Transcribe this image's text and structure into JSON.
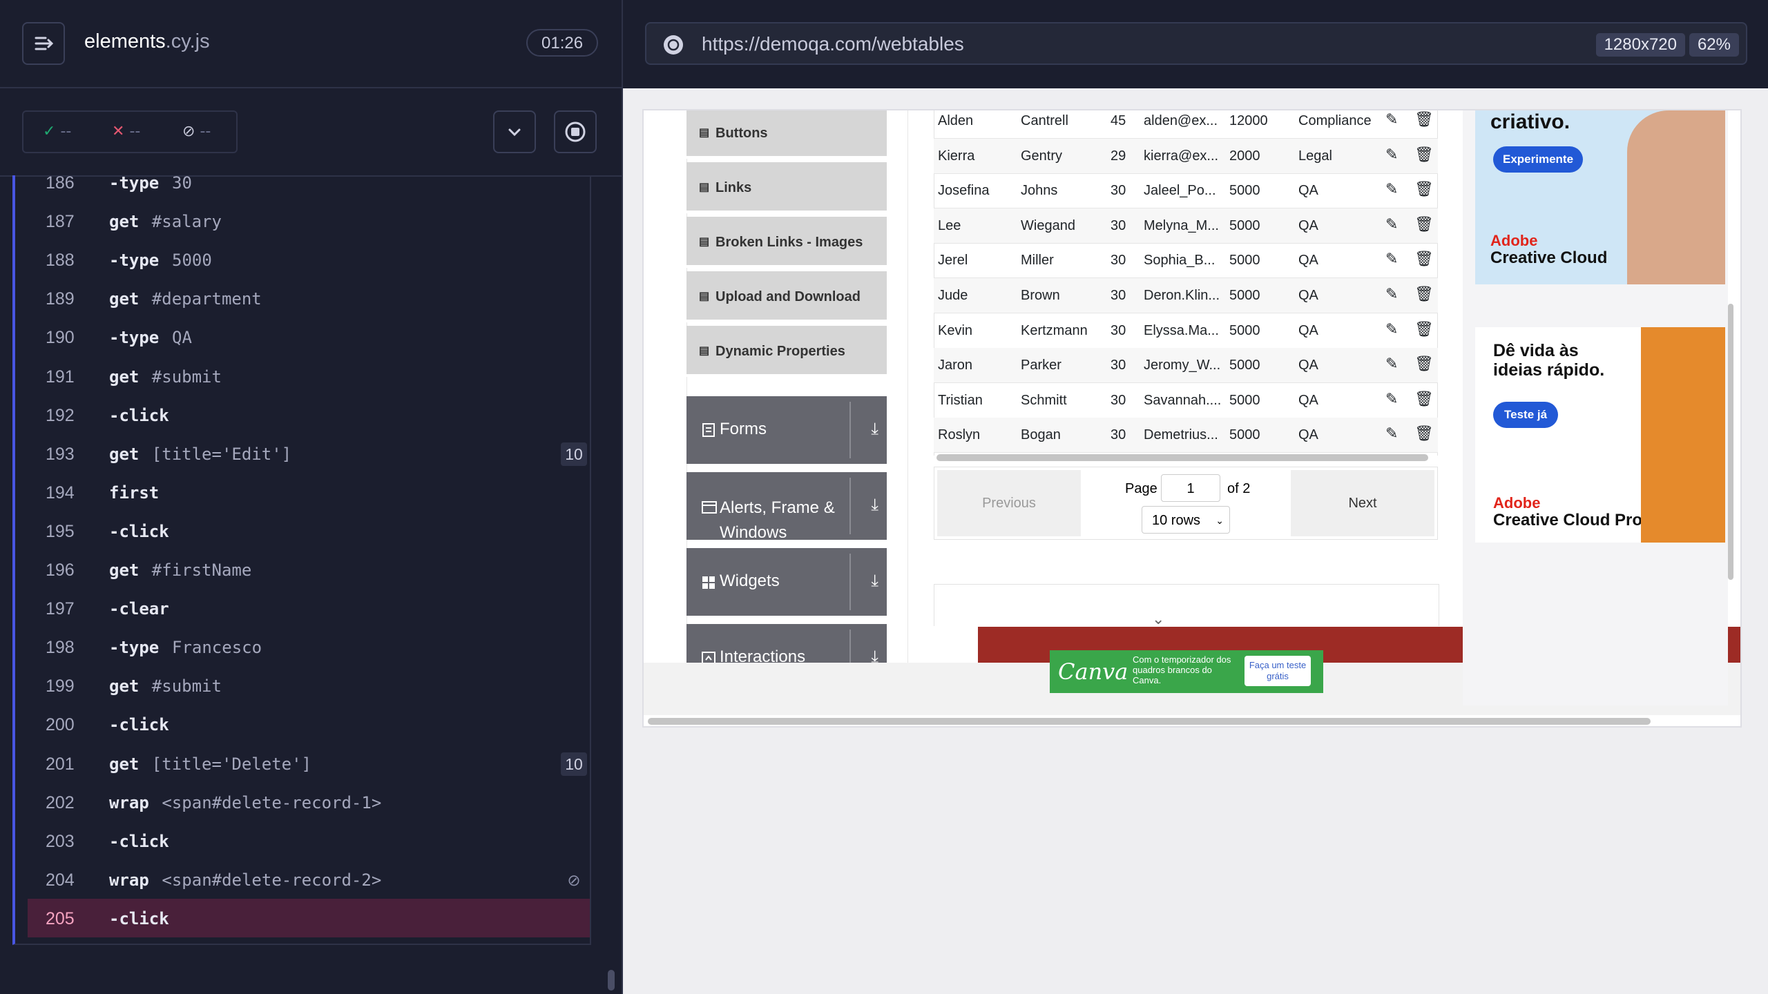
{
  "reporter": {
    "spec_file": "elements",
    "spec_ext": ".cy.js",
    "timer": "01:26",
    "stats": {
      "passed": "--",
      "failed": "--",
      "pending": "--"
    },
    "commands": [
      {
        "num": "186",
        "name": "-type",
        "msg": "30",
        "badge": ""
      },
      {
        "num": "187",
        "name": "get",
        "msg": "#salary",
        "badge": ""
      },
      {
        "num": "188",
        "name": "-type",
        "msg": "5000",
        "badge": ""
      },
      {
        "num": "189",
        "name": "get",
        "msg": "#department",
        "badge": ""
      },
      {
        "num": "190",
        "name": "-type",
        "msg": "QA",
        "badge": ""
      },
      {
        "num": "191",
        "name": "get",
        "msg": "#submit",
        "badge": ""
      },
      {
        "num": "192",
        "name": "-click",
        "msg": "",
        "badge": ""
      },
      {
        "num": "193",
        "name": "get",
        "msg": "[title='Edit']",
        "badge": "10"
      },
      {
        "num": "194",
        "name": "first",
        "msg": "",
        "badge": ""
      },
      {
        "num": "195",
        "name": "-click",
        "msg": "",
        "badge": ""
      },
      {
        "num": "196",
        "name": "get",
        "msg": "#firstName",
        "badge": ""
      },
      {
        "num": "197",
        "name": "-clear",
        "msg": "",
        "badge": ""
      },
      {
        "num": "198",
        "name": "-type",
        "msg": "Francesco",
        "badge": ""
      },
      {
        "num": "199",
        "name": "get",
        "msg": "#submit",
        "badge": ""
      },
      {
        "num": "200",
        "name": "-click",
        "msg": "",
        "badge": ""
      },
      {
        "num": "201",
        "name": "get",
        "msg": "[title='Delete']",
        "badge": "10"
      },
      {
        "num": "202",
        "name": "wrap",
        "msg": "<span#delete-record-1>",
        "badge": ""
      },
      {
        "num": "203",
        "name": "-click",
        "msg": "",
        "badge": ""
      },
      {
        "num": "204",
        "name": "wrap",
        "msg": "<span#delete-record-2>",
        "badge": ""
      },
      {
        "num": "205",
        "name": "-click",
        "msg": "",
        "badge": ""
      }
    ]
  },
  "aut": {
    "url": "https://demoqa.com/webtables",
    "viewport": "1280x720",
    "zoom": "62%",
    "sidebar": {
      "items": [
        "Buttons",
        "Links",
        "Broken Links - Images",
        "Upload and Download",
        "Dynamic Properties"
      ],
      "groups": [
        "Forms",
        "Alerts, Frame & Windows",
        "Widgets",
        "Interactions"
      ]
    },
    "table": {
      "rows": [
        {
          "first": "Alden",
          "last": "Cantrell",
          "age": "45",
          "email": "alden@ex...",
          "salary": "12000",
          "dept": "Compliance"
        },
        {
          "first": "Kierra",
          "last": "Gentry",
          "age": "29",
          "email": "kierra@ex...",
          "salary": "2000",
          "dept": "Legal"
        },
        {
          "first": "Josefina",
          "last": "Johns",
          "age": "30",
          "email": "Jaleel_Po...",
          "salary": "5000",
          "dept": "QA"
        },
        {
          "first": "Lee",
          "last": "Wiegand",
          "age": "30",
          "email": "Melyna_M...",
          "salary": "5000",
          "dept": "QA"
        },
        {
          "first": "Jerel",
          "last": "Miller",
          "age": "30",
          "email": "Sophia_B...",
          "salary": "5000",
          "dept": "QA"
        },
        {
          "first": "Jude",
          "last": "Brown",
          "age": "30",
          "email": "Deron.Klin...",
          "salary": "5000",
          "dept": "QA"
        },
        {
          "first": "Kevin",
          "last": "Kertzmann",
          "age": "30",
          "email": "Elyssa.Ma...",
          "salary": "5000",
          "dept": "QA"
        },
        {
          "first": "Jaron",
          "last": "Parker",
          "age": "30",
          "email": "Jeromy_W...",
          "salary": "5000",
          "dept": "QA"
        },
        {
          "first": "Tristian",
          "last": "Schmitt",
          "age": "30",
          "email": "Savannah....",
          "salary": "5000",
          "dept": "QA"
        },
        {
          "first": "Roslyn",
          "last": "Bogan",
          "age": "30",
          "email": "Demetrius...",
          "salary": "5000",
          "dept": "QA"
        }
      ],
      "pagination": {
        "previous": "Previous",
        "next": "Next",
        "page_label": "Page",
        "page_value": "1",
        "of_label": "of 2",
        "rows_select": "10 rows"
      }
    },
    "ads": {
      "ad1_text": "criativo.",
      "ad1_button": "Experimente",
      "ad1_brand_1": "Adobe",
      "ad1_brand_2": "Creative Cloud",
      "ad2_text_1": "Dê vida às",
      "ad2_text_2": "ideias rápido.",
      "ad2_button": "Teste já",
      "ad2_brand_1": "Adobe",
      "ad2_brand_2": "Creative Cloud Pro",
      "canva_logo": "Canva",
      "canva_text": "Com o temporizador dos quadros brancos do Canva.",
      "canva_button": "Faça um teste grátis"
    }
  }
}
